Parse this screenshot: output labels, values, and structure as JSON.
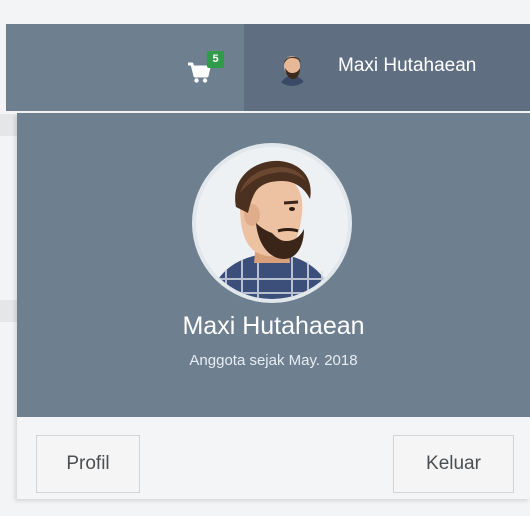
{
  "navbar": {
    "cart_badge": "5",
    "username": "Maxi Hutahaean"
  },
  "dropdown": {
    "name": "Maxi Hutahaean",
    "member_since": "Anggota sejak May. 2018",
    "profile_button": "Profil",
    "logout_button": "Keluar"
  },
  "colors": {
    "navbar": "#6e7f90",
    "navbar_user": "#5f6f81",
    "badge": "#2e9c48",
    "dropdown_footer": "#f4f5f6"
  }
}
